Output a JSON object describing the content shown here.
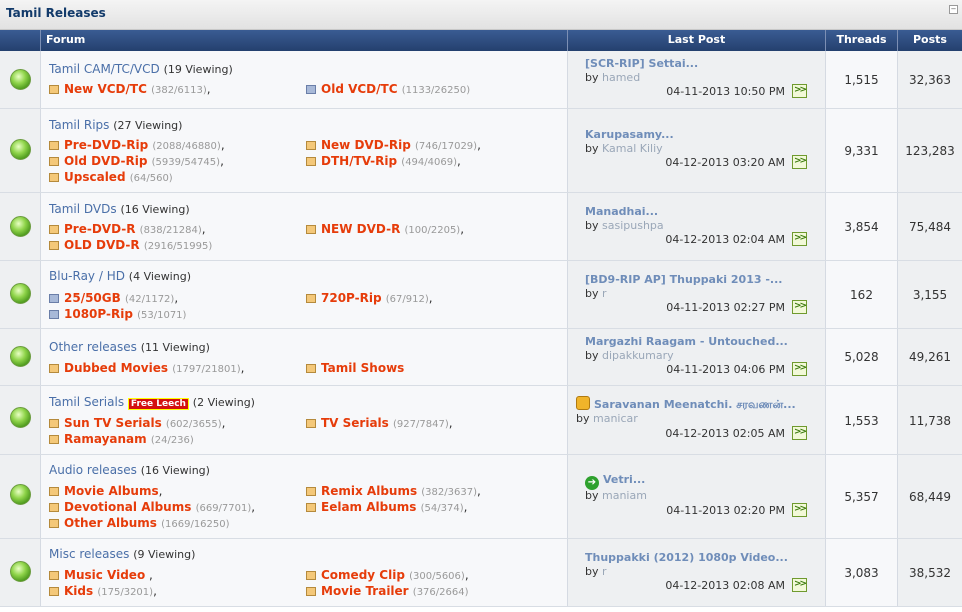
{
  "category": {
    "title": "Tamil Releases"
  },
  "columns": {
    "forum": "Forum",
    "last_post": "Last Post",
    "threads": "Threads",
    "posts": "Posts"
  },
  "forums": [
    {
      "title": "Tamil CAM/TC/VCD",
      "viewing": "(19 Viewing)",
      "subs": [
        {
          "name": "New VCD/TC",
          "count": "(382/6113)",
          "sep": ","
        },
        {
          "name": "Old VCD/TC",
          "count": "(1133/26250)",
          "sep": ""
        }
      ],
      "last": {
        "title": "[SCR-RIP] Settai...",
        "by": "by",
        "user": "hamed",
        "date": "04-11-2013",
        "time": "10:50 PM"
      },
      "threads": "1,515",
      "posts": "32,363"
    },
    {
      "title": "Tamil Rips",
      "viewing": "(27 Viewing)",
      "subs": [
        {
          "name": "Pre-DVD-Rip",
          "count": "(2088/46880)",
          "sep": ","
        },
        {
          "name": "New DVD-Rip",
          "count": "(746/17029)",
          "sep": ","
        },
        {
          "name": "Old DVD-Rip",
          "count": "(5939/54745)",
          "sep": ","
        },
        {
          "name": "DTH/TV-Rip",
          "count": "(494/4069)",
          "sep": ","
        },
        {
          "name": "Upscaled",
          "count": "(64/560)",
          "sep": ""
        }
      ],
      "last": {
        "title": "Karupasamy...",
        "by": "by",
        "user": "Kamal Kiliy",
        "date": "04-12-2013",
        "time": "03:20 AM"
      },
      "threads": "9,331",
      "posts": "123,283"
    },
    {
      "title": "Tamil DVDs",
      "viewing": "(16 Viewing)",
      "subs": [
        {
          "name": "Pre-DVD-R",
          "count": "(838/21284)",
          "sep": ","
        },
        {
          "name": "NEW DVD-R",
          "count": "(100/2205)",
          "sep": ","
        },
        {
          "name": "OLD DVD-R",
          "count": "(2916/51995)",
          "sep": ""
        }
      ],
      "last": {
        "title": "Manadhai...",
        "by": "by",
        "user": "sasipushpa",
        "date": "04-12-2013",
        "time": "02:04 AM"
      },
      "threads": "3,854",
      "posts": "75,484"
    },
    {
      "title": "Blu-Ray / HD",
      "viewing": "(4 Viewing)",
      "subs": [
        {
          "name": "25/50GB",
          "count": "(42/1172)",
          "sep": ","
        },
        {
          "name": "720P-Rip",
          "count": "(67/912)",
          "sep": ","
        },
        {
          "name": "1080P-Rip",
          "count": "(53/1071)",
          "sep": ""
        }
      ],
      "last": {
        "title": "[BD9-RIP AP] Thuppaki 2013 -...",
        "by": "by",
        "user": "r",
        "date": "04-11-2013",
        "time": "02:27 PM"
      },
      "threads": "162",
      "posts": "3,155"
    },
    {
      "title": "Other releases",
      "viewing": "(11 Viewing)",
      "subs": [
        {
          "name": "Dubbed Movies",
          "count": "(1797/21801)",
          "sep": ","
        },
        {
          "name": "Tamil Shows",
          "count": "",
          "sep": ""
        }
      ],
      "last": {
        "title": "Margazhi Raagam - Untouched...",
        "by": "by",
        "user": "dipakkumary",
        "date": "04-11-2013",
        "time": "04:06 PM"
      },
      "threads": "5,028",
      "posts": "49,261"
    },
    {
      "title": "Tamil Serials",
      "badge": "Free Leech",
      "viewing": "(2 Viewing)",
      "subs": [
        {
          "name": "Sun TV Serials",
          "count": "(602/3655)",
          "sep": ","
        },
        {
          "name": "TV Serials",
          "count": "(927/7847)",
          "sep": ","
        },
        {
          "name": "Ramayanam",
          "count": "(24/236)",
          "sep": ""
        }
      ],
      "last": {
        "title": "Saravanan Meenatchi. சரவணன்...",
        "by": "by",
        "user": "manicar",
        "date": "04-12-2013",
        "time": "02:05 AM"
      },
      "threads": "1,553",
      "posts": "11,738"
    },
    {
      "title": "Audio releases",
      "viewing": "(16 Viewing)",
      "subs": [
        {
          "name": "Movie Albums",
          "count": "",
          "sep": ","
        },
        {
          "name": "Remix Albums",
          "count": "(382/3637)",
          "sep": ","
        },
        {
          "name": "Devotional Albums",
          "count": "(669/7701)",
          "sep": ","
        },
        {
          "name": "Eelam Albums",
          "count": "(54/374)",
          "sep": ","
        },
        {
          "name": "Other Albums",
          "count": "(1669/16250)",
          "sep": ""
        }
      ],
      "last": {
        "title": "Vetri...",
        "by": "by",
        "user": "maniam",
        "date": "04-11-2013",
        "time": "02:20 PM"
      },
      "threads": "5,357",
      "posts": "68,449"
    },
    {
      "title": "Misc releases",
      "viewing": "(9 Viewing)",
      "subs": [
        {
          "name": "Music Video",
          "count": "",
          "sep": " ,"
        },
        {
          "name": "Comedy Clip",
          "count": "(300/5606)",
          "sep": ","
        },
        {
          "name": "Kids",
          "count": "(175/3201)",
          "sep": ","
        },
        {
          "name": "Movie Trailer",
          "count": "(376/2664)",
          "sep": ""
        }
      ],
      "last": {
        "title": "Thuppakki (2012) 1080p Video...",
        "by": "by",
        "user": "r",
        "date": "04-12-2013",
        "time": "02:08 AM"
      },
      "threads": "3,083",
      "posts": "38,532"
    }
  ]
}
